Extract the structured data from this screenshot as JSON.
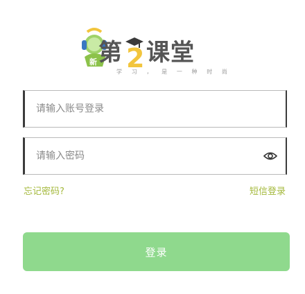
{
  "logo": {
    "title_prefix": "第",
    "title_number": "2",
    "title_suffix": "课堂",
    "slogan": [
      "学",
      "习",
      "，",
      "是",
      "一",
      "种",
      "时",
      "尚"
    ],
    "colors": {
      "text": "#555555",
      "accent_yellow": "#f2c53d",
      "accent_green": "#8cc24a",
      "accent_blue": "#3a78c2"
    }
  },
  "form": {
    "account": {
      "value": "",
      "placeholder": "请输入账号登录"
    },
    "password": {
      "value": "",
      "placeholder": "请输入密码",
      "toggle_icon": "eye-icon"
    }
  },
  "links": {
    "forgot_password": "忘记密码?",
    "sms_login": "短信登录"
  },
  "login_button": {
    "label": "登录",
    "color": "#8fd98d"
  }
}
